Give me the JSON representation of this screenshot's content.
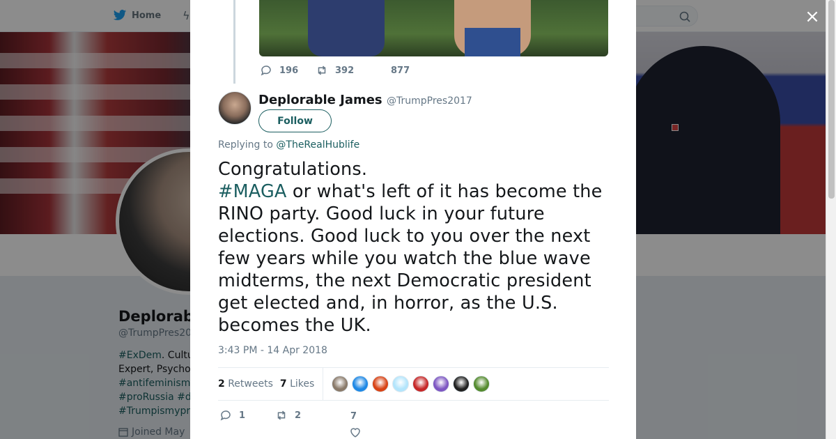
{
  "nav": {
    "home_label": "Home"
  },
  "profile": {
    "name": "Deplorab",
    "handle": "@TrumpPres20",
    "bio_lines": [
      {
        "tag": "#ExDem",
        "text": ". Cultu"
      },
      {
        "tag": "",
        "text": "Expert, Psycho"
      },
      {
        "tag": "#antifeminism",
        "text": ""
      },
      {
        "tag": "#proRussia",
        "text": " #d"
      },
      {
        "tag": "#Trumpismypr",
        "text": ""
      }
    ],
    "joined": "Joined May"
  },
  "close_label": "×",
  "parent_tweet": {
    "replies": "196",
    "retweets": "392",
    "likes": "877"
  },
  "tweet": {
    "author_name": "Deplorable James",
    "author_handle": "@TrumpPres2017",
    "follow_label": "Follow",
    "replying_prefix": "Replying to",
    "replying_to": "@TheRealHublife",
    "text_line1": "Congratulations.",
    "hashtag": "#MAGA",
    "text_rest": " or what's left of it has become the RINO party. Good luck in your future elections. Good luck to you over the next few years while you watch the blue wave midterms, the next Democratic president get elected and, in horror, as the U.S. becomes the UK.",
    "timestamp": "3:43 PM - 14 Apr 2018",
    "retweet_count": "2",
    "retweet_label": "Retweets",
    "like_count": "7",
    "like_label": "Likes",
    "liker_colors": [
      "#8a7a6a",
      "#1e88e5",
      "#d84315",
      "#b3e5fc",
      "#c62828",
      "#7e57c2",
      "#212121",
      "#558b2f"
    ],
    "actions": {
      "replies": "1",
      "retweets": "2",
      "likes": "7"
    }
  }
}
